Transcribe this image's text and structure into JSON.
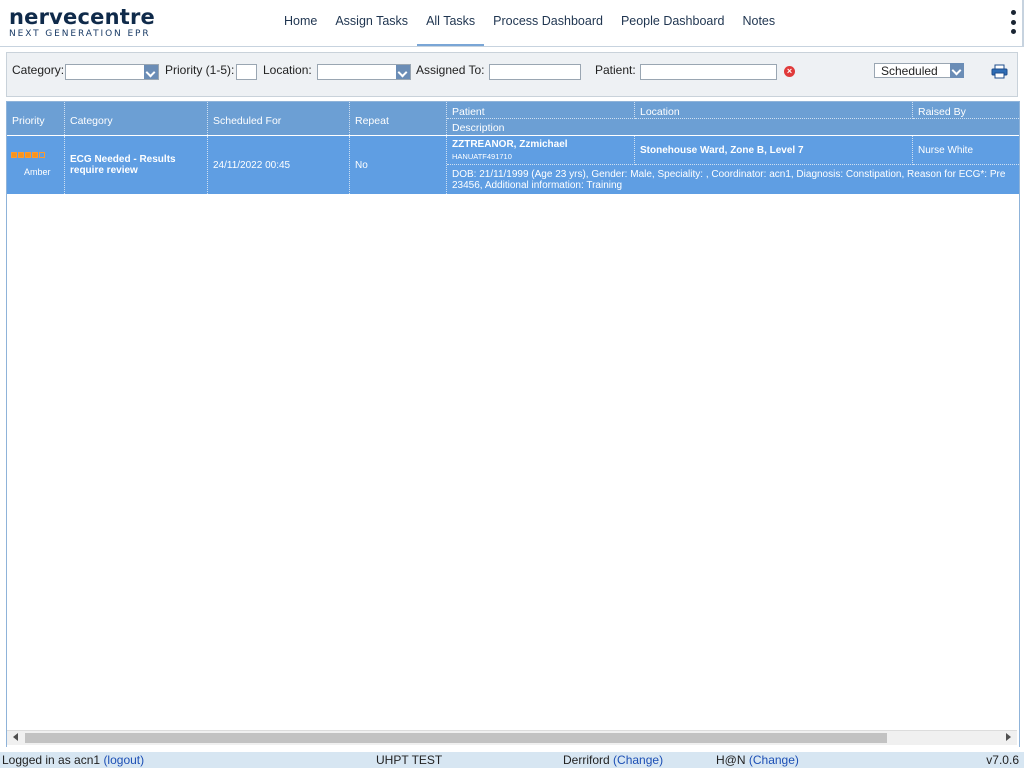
{
  "logo": {
    "name": "nervecentre",
    "tagline": "NEXT GENERATION EPR"
  },
  "nav": {
    "items": [
      "Home",
      "Assign Tasks",
      "All Tasks",
      "Process Dashboard",
      "People Dashboard",
      "Notes"
    ],
    "active": "All Tasks"
  },
  "filters": {
    "category_label": "Category:",
    "priority_label": "Priority (1-5):",
    "location_label": "Location:",
    "assigned_label": "Assigned To:",
    "patient_label": "Patient:",
    "status_selected": "Scheduled"
  },
  "table": {
    "headers": {
      "priority": "Priority",
      "category": "Category",
      "scheduled_for": "Scheduled For",
      "repeat": "Repeat",
      "patient": "Patient",
      "location": "Location",
      "raised_by": "Raised By",
      "description": "Description"
    },
    "rows": [
      {
        "priority_label": "Amber",
        "priority_level": 4,
        "category_line1": "ECG Needed - Results",
        "category_line2": "require review",
        "scheduled_for": "24/11/2022 00:45",
        "repeat": "No",
        "patient_name": "ZZTREANOR, Zzmichael",
        "patient_id": "HANUATF491710",
        "location": "Stonehouse Ward, Zone B, Level 7",
        "raised_by": "Nurse White",
        "description_line1": "DOB: 21/11/1999 (Age 23 yrs), Gender: Male, Speciality: , Coordinator: acn1, Diagnosis: Constipation, Reason for ECG*: Pre",
        "description_line2": "23456, Additional information: Training"
      }
    ]
  },
  "status": {
    "logged_in_text": "Logged in as acn1",
    "logout_label": "(logout)",
    "environment": "UHPT TEST",
    "site": "Derriford",
    "site_change": "(Change)",
    "team": "H@N",
    "team_change": "(Change)",
    "version": "v7.0.6"
  },
  "colors": {
    "header_blue": "#6c9fd4",
    "row_selected": "#5f9ee3",
    "priority_amber": "#f7941d",
    "clear_red": "#e03a3a",
    "link_blue": "#1c4fb5"
  }
}
